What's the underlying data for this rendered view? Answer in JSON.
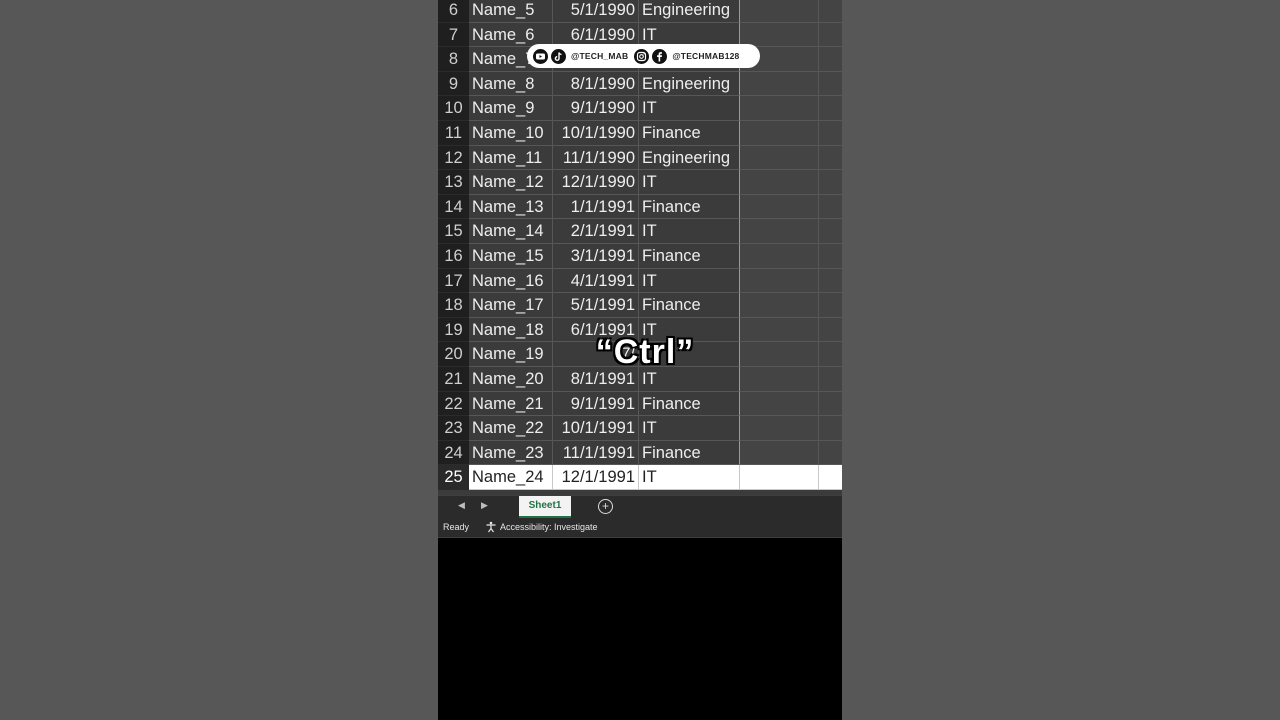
{
  "social": {
    "handle_left": "@TECH_MAB",
    "handle_right": "@TECHMAB128",
    "icons": [
      "youtube-icon",
      "tiktok-icon",
      "instagram-icon",
      "facebook-icon"
    ]
  },
  "caption": "“Ctrl”",
  "spreadsheet": {
    "rows": [
      {
        "num": "6",
        "name": "Name_5",
        "date": "5/1/1990",
        "dept": "Engineering"
      },
      {
        "num": "7",
        "name": "Name_6",
        "date": "6/1/1990",
        "dept": "IT"
      },
      {
        "num": "8",
        "name": "Name_7",
        "date": "",
        "dept": ""
      },
      {
        "num": "9",
        "name": "Name_8",
        "date": "8/1/1990",
        "dept": "Engineering"
      },
      {
        "num": "10",
        "name": "Name_9",
        "date": "9/1/1990",
        "dept": "IT"
      },
      {
        "num": "11",
        "name": "Name_10",
        "date": "10/1/1990",
        "dept": "Finance"
      },
      {
        "num": "12",
        "name": "Name_11",
        "date": "11/1/1990",
        "dept": "Engineering"
      },
      {
        "num": "13",
        "name": "Name_12",
        "date": "12/1/1990",
        "dept": "IT"
      },
      {
        "num": "14",
        "name": "Name_13",
        "date": "1/1/1991",
        "dept": "Finance"
      },
      {
        "num": "15",
        "name": "Name_14",
        "date": "2/1/1991",
        "dept": "IT"
      },
      {
        "num": "16",
        "name": "Name_15",
        "date": "3/1/1991",
        "dept": "Finance"
      },
      {
        "num": "17",
        "name": "Name_16",
        "date": "4/1/1991",
        "dept": "IT"
      },
      {
        "num": "18",
        "name": "Name_17",
        "date": "5/1/1991",
        "dept": "Finance"
      },
      {
        "num": "19",
        "name": "Name_18",
        "date": "6/1/1991",
        "dept": "IT"
      },
      {
        "num": "20",
        "name": "Name_19",
        "date": "7/",
        "dept": ""
      },
      {
        "num": "21",
        "name": "Name_20",
        "date": "8/1/1991",
        "dept": "IT"
      },
      {
        "num": "22",
        "name": "Name_21",
        "date": "9/1/1991",
        "dept": "Finance"
      },
      {
        "num": "23",
        "name": "Name_22",
        "date": "10/1/1991",
        "dept": "IT"
      },
      {
        "num": "24",
        "name": "Name_23",
        "date": "11/1/1991",
        "dept": "Finance"
      },
      {
        "num": "25",
        "name": "Name_24",
        "date": "12/1/1991",
        "dept": "IT"
      }
    ],
    "selected_row": "25"
  },
  "tabbar": {
    "sheet_tab": "Sheet1",
    "prev_arrow": "◀",
    "next_arrow": "▶",
    "add_sheet": "+"
  },
  "statusbar": {
    "ready": "Ready",
    "accessibility": "Accessibility: Investigate"
  }
}
